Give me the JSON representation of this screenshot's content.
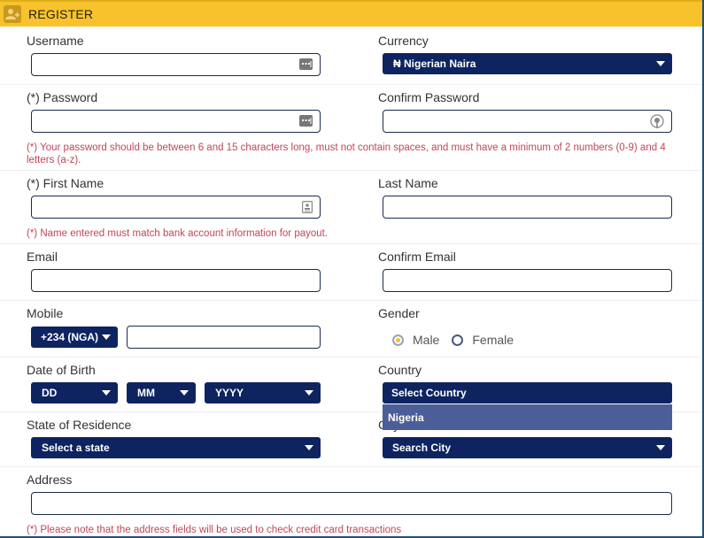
{
  "header": {
    "title": "REGISTER",
    "icon": "add-user-icon",
    "accent": "#f7c22b"
  },
  "colors": {
    "select_bg": "#0e2461",
    "note_text": "#c0465a",
    "dropdown_highlight": "#4b5e97"
  },
  "form": {
    "username": {
      "label": "Username",
      "value": "",
      "icon": "keyboard-icon"
    },
    "currency": {
      "label": "Currency",
      "selected": "₦ Nigerian Naira"
    },
    "password": {
      "label": "(*) Password",
      "value": "",
      "icon": "keyboard-icon"
    },
    "confirm_password": {
      "label": "Confirm Password",
      "value": "",
      "icon": "key-icon"
    },
    "password_note": "(*) Your password should be between 6 and 15 characters long, must not contain spaces, and must have a minimum of 2 numbers (0-9) and 4 letters (a-z).",
    "first_name": {
      "label": "(*) First Name",
      "value": "",
      "icon": "contact-card-icon"
    },
    "last_name": {
      "label": "Last Name",
      "value": ""
    },
    "name_note": "(*) Name entered must match bank account information for payout.",
    "email": {
      "label": "Email",
      "value": ""
    },
    "confirm_email": {
      "label": "Confirm Email",
      "value": ""
    },
    "mobile": {
      "label": "Mobile",
      "country_code": "+234 (NGA)",
      "value": ""
    },
    "gender": {
      "label": "Gender",
      "options": [
        "Male",
        "Female"
      ],
      "selected": "Male"
    },
    "dob": {
      "label": "Date of Birth",
      "day": "DD",
      "month": "MM",
      "year": "YYYY"
    },
    "country": {
      "label": "Country",
      "selected": "Select Country",
      "open_options": [
        "Nigeria"
      ]
    },
    "state": {
      "label": "State of Residence",
      "selected": "Select a state"
    },
    "city": {
      "label": "City",
      "selected": "Search City"
    },
    "address": {
      "label": "Address",
      "value": ""
    },
    "address_note": "(*) Please note that the address fields will be used to check credit card transactions"
  }
}
